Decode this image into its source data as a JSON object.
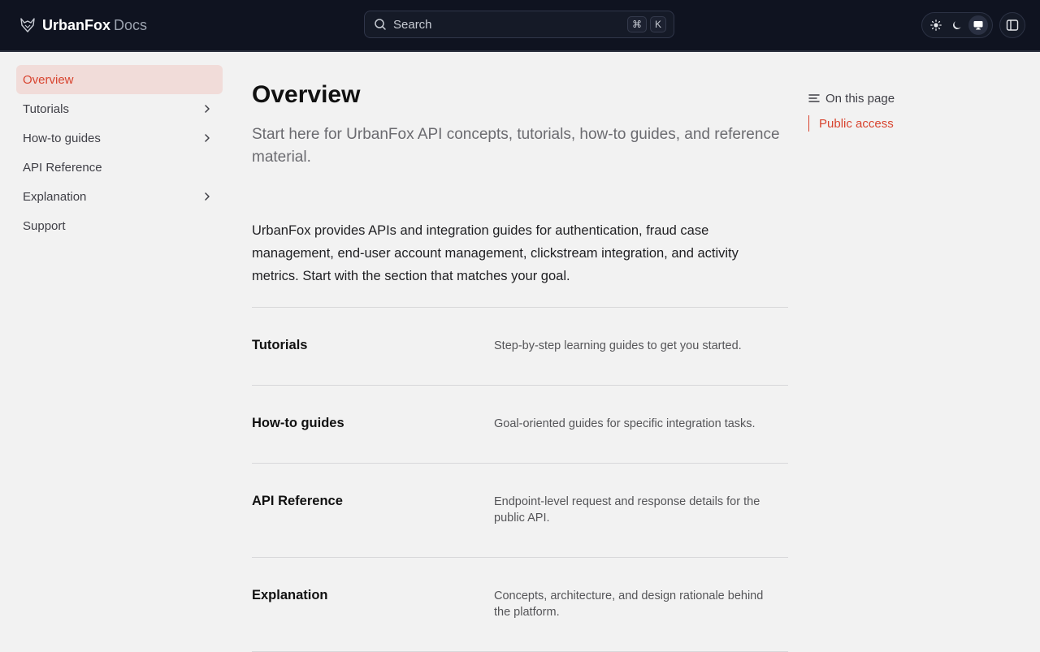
{
  "header": {
    "brand_name": "UrbanFox",
    "brand_suffix": "Docs",
    "search": {
      "placeholder": "Search",
      "shortcut_keys": [
        "⌘",
        "K"
      ]
    },
    "theme_options": [
      "light",
      "dark",
      "system"
    ],
    "theme_selected": "system"
  },
  "sidebar": {
    "items": [
      {
        "label": "Overview",
        "active": true,
        "expandable": false
      },
      {
        "label": "Tutorials",
        "active": false,
        "expandable": true
      },
      {
        "label": "How-to guides",
        "active": false,
        "expandable": true
      },
      {
        "label": "API Reference",
        "active": false,
        "expandable": false
      },
      {
        "label": "Explanation",
        "active": false,
        "expandable": true
      },
      {
        "label": "Support",
        "active": false,
        "expandable": false
      }
    ]
  },
  "main": {
    "title": "Overview",
    "lead": "Start here for UrbanFox API concepts, tutorials, how-to guides, and reference material.",
    "intro": "UrbanFox provides APIs and integration guides for authentication, fraud case management, end-user account management, clickstream integration, and activity metrics. Start with the section that matches your goal.",
    "sections": [
      {
        "title": "Tutorials",
        "description": "Step-by-step learning guides to get you started."
      },
      {
        "title": "How-to guides",
        "description": "Goal-oriented guides for specific integration tasks."
      },
      {
        "title": "API Reference",
        "description": "Endpoint-level request and response details for the public API."
      },
      {
        "title": "Explanation",
        "description": "Concepts, architecture, and design rationale behind the platform."
      }
    ]
  },
  "toc": {
    "heading": "On this page",
    "links": [
      "Public access"
    ]
  },
  "colors": {
    "accent": "#d8442f",
    "header_bg": "#0f1320",
    "page_bg": "#f2f2f2",
    "active_nav_bg": "#f1dcd9"
  }
}
